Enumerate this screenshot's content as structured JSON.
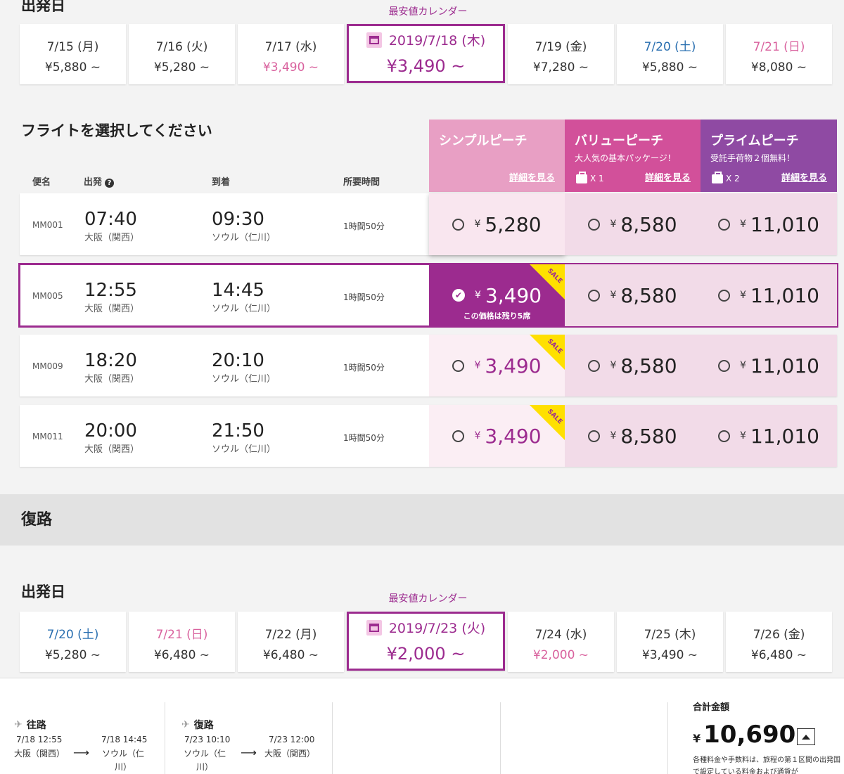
{
  "outbound": {
    "title": "出発日",
    "calendar_link": "最安値カレンダー",
    "dates": [
      {
        "date": "7/15 (月)",
        "price": "¥5,880 ~",
        "date_color": "default",
        "price_color": "default"
      },
      {
        "date": "7/16 (火)",
        "price": "¥5,280 ~",
        "date_color": "default",
        "price_color": "default"
      },
      {
        "date": "7/17 (水)",
        "price": "¥3,490 ~",
        "date_color": "default",
        "price_color": "pink"
      },
      {
        "date": "2019/7/18 (木)",
        "price": "¥3,490 ~",
        "selected": true
      },
      {
        "date": "7/19 (金)",
        "price": "¥7,280 ~",
        "date_color": "default",
        "price_color": "default"
      },
      {
        "date": "7/20 (土)",
        "price": "¥5,880 ~",
        "date_color": "blue",
        "price_color": "default"
      },
      {
        "date": "7/21 (日)",
        "price": "¥8,080 ~",
        "date_color": "pink",
        "price_color": "default"
      }
    ]
  },
  "flights": {
    "title": "フライトを選択してください",
    "columns": {
      "flight": "便名",
      "depart": "出発",
      "arrive": "到着",
      "duration": "所要時間"
    },
    "fares": [
      {
        "name": "シンプルピーチ",
        "sub": "",
        "bag": "",
        "detail": "詳細を見る",
        "color": "#e89fc4"
      },
      {
        "name": "バリューピーチ",
        "sub": "大人気の基本パッケージ！",
        "bag": "X 1",
        "detail": "詳細を見る",
        "color": "#d2509a"
      },
      {
        "name": "プライムピーチ",
        "sub": "受託手荷物２個無料！",
        "bag": "X 2",
        "detail": "詳細を見る",
        "color": "#8f4aa3"
      }
    ],
    "rows": [
      {
        "no": "MM001",
        "dep": "07:40",
        "dep_ap": "大阪（関西）",
        "arr": "09:30",
        "arr_ap": "ソウル（仁川）",
        "dur": "1時間50分",
        "simple": "5,280",
        "value": "8,580",
        "prime": "11,010",
        "sale": false,
        "selected": false
      },
      {
        "no": "MM005",
        "dep": "12:55",
        "dep_ap": "大阪（関西）",
        "arr": "14:45",
        "arr_ap": "ソウル（仁川）",
        "dur": "1時間50分",
        "simple": "3,490",
        "value": "8,580",
        "prime": "11,010",
        "sale": true,
        "selected": true,
        "remain": "この価格は残り5席"
      },
      {
        "no": "MM009",
        "dep": "18:20",
        "dep_ap": "大阪（関西）",
        "arr": "20:10",
        "arr_ap": "ソウル（仁川）",
        "dur": "1時間50分",
        "simple": "3,490",
        "value": "8,580",
        "prime": "11,010",
        "sale": true,
        "selected": false
      },
      {
        "no": "MM011",
        "dep": "20:00",
        "dep_ap": "大阪（関西）",
        "arr": "21:50",
        "arr_ap": "ソウル（仁川）",
        "dur": "1時間50分",
        "simple": "3,490",
        "value": "8,580",
        "prime": "11,010",
        "sale": true,
        "selected": false
      }
    ],
    "sale_label": "SALE",
    "yen": "¥"
  },
  "return_band": {
    "title": "復路"
  },
  "inbound": {
    "title": "出発日",
    "calendar_link": "最安値カレンダー",
    "dates": [
      {
        "date": "7/20 (土)",
        "price": "¥5,280 ~",
        "date_color": "blue",
        "price_color": "default"
      },
      {
        "date": "7/21 (日)",
        "price": "¥6,480 ~",
        "date_color": "pink",
        "price_color": "default"
      },
      {
        "date": "7/22 (月)",
        "price": "¥6,480 ~",
        "date_color": "default",
        "price_color": "default"
      },
      {
        "date": "2019/7/23 (火)",
        "price": "¥2,000 ~",
        "selected": true
      },
      {
        "date": "7/24 (水)",
        "price": "¥2,000 ~",
        "date_color": "default",
        "price_color": "pink"
      },
      {
        "date": "7/25 (木)",
        "price": "¥3,490 ~",
        "date_color": "default",
        "price_color": "default"
      },
      {
        "date": "7/26 (金)",
        "price": "¥6,480 ~",
        "date_color": "default",
        "price_color": "default"
      }
    ]
  },
  "summary": {
    "out": {
      "label": "往路",
      "dep_time": "7/18 12:55",
      "dep_ap": "大阪（関西）",
      "arr_time": "7/18 14:45",
      "arr_ap": "ソウル（仁川）"
    },
    "ret": {
      "label": "復路",
      "dep_time": "7/23 10:10",
      "dep_ap": "ソウル（仁川）",
      "arr_time": "7/23 12:00",
      "arr_ap": "大阪（関西）"
    },
    "total_label": "合計金額",
    "total_yen": "¥",
    "total_value": "10,690",
    "note": "各種料金や手数料は、旅程の第１区間の出発国で設定している料金および通貨が"
  },
  "icons": {
    "help": "question-icon",
    "calendar": "calendar-icon",
    "plane": "plane-icon",
    "bag": "baggage-icon",
    "check": "check-icon",
    "toggle": "chevron-up-icon"
  },
  "colors": {
    "accent": "#9c2b8f",
    "sale": "#ffe000",
    "blue": "#2a6fb0",
    "pink": "#d9629e"
  }
}
